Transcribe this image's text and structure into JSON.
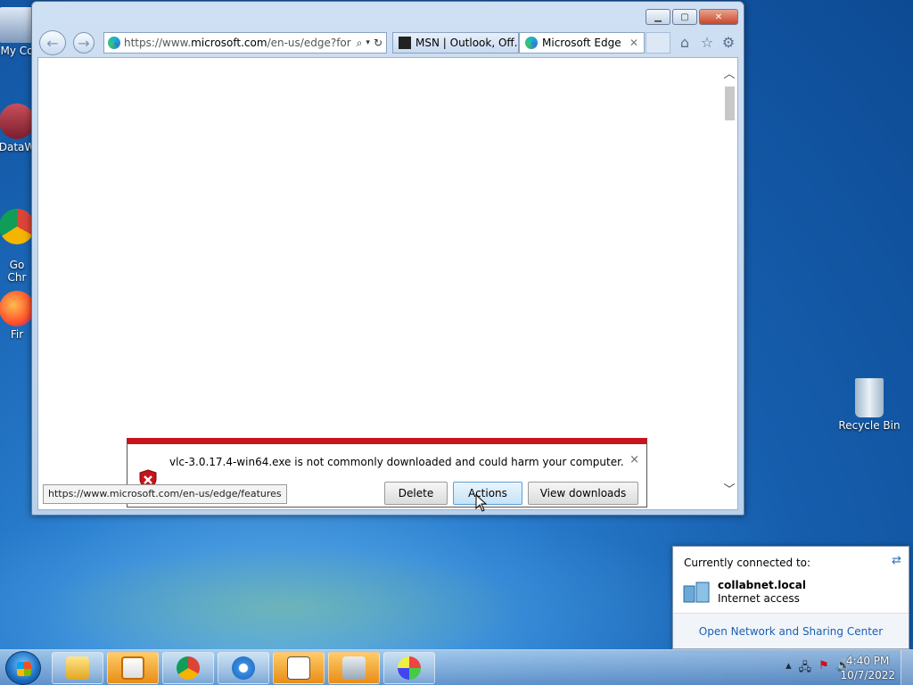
{
  "desktop": {
    "icons": [
      {
        "label": "My Co"
      },
      {
        "label": "DataW"
      },
      {
        "label": "Go\nChr"
      },
      {
        "label": "Fir"
      },
      {
        "label": "Recycle Bin"
      }
    ]
  },
  "browser": {
    "address_prefix": "https://www.",
    "address_host": "microsoft.com",
    "address_rest": "/en-us/edge?for",
    "tabs": [
      {
        "label": "MSN | Outlook, Off...",
        "icon": "msn-icon"
      },
      {
        "label": "Microsoft Edge",
        "icon": "edge-icon",
        "active": true
      }
    ],
    "status_url": "https://www.microsoft.com/en-us/edge/features"
  },
  "download_bar": {
    "message": "vlc-3.0.17.4-win64.exe is not commonly downloaded and could harm your computer.",
    "delete_label": "Delete",
    "actions_label": "Actions",
    "view_downloads_label": "View downloads",
    "close_glyph": "×"
  },
  "network_popup": {
    "header": "Currently connected to:",
    "network_name": "collabnet.local",
    "network_status": "Internet access",
    "footer_link": "Open Network and Sharing Center"
  },
  "taskbar": {
    "time": "4:40 PM",
    "date": "10/7/2022"
  },
  "colors": {
    "warning_red": "#c8141c",
    "link_blue": "#1c5fb0"
  }
}
